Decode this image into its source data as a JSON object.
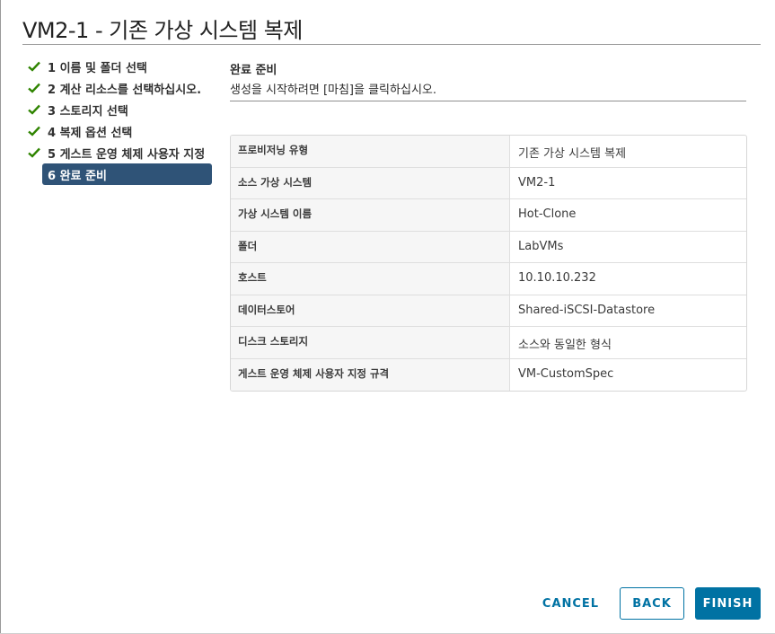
{
  "window": {
    "title": "VM2-1 - 기존 가상 시스템 복제"
  },
  "steps": [
    {
      "label": "1 이름 및 폴더 선택",
      "completed": true
    },
    {
      "label": "2 계산 리소스를 선택하십시오.",
      "completed": true
    },
    {
      "label": "3 스토리지 선택",
      "completed": true
    },
    {
      "label": "4 복제 옵션 선택",
      "completed": true
    },
    {
      "label": "5 게스트 운영 체제 사용자 지정",
      "completed": true
    },
    {
      "label": "6 완료 준비",
      "completed": false,
      "active": true
    }
  ],
  "content": {
    "title": "완료 준비",
    "description": "생성을 시작하려면 [마침]을 클릭하십시오."
  },
  "summary": [
    {
      "label": "프로비저닝 유형",
      "value": "기존 가상 시스템 복제"
    },
    {
      "label": "소스 가상 시스템",
      "value": "VM2-1"
    },
    {
      "label": "가상 시스템 이름",
      "value": "Hot-Clone"
    },
    {
      "label": "폴더",
      "value": "LabVMs"
    },
    {
      "label": "호스트",
      "value": "10.10.10.232"
    },
    {
      "label": "데이터스토어",
      "value": "Shared-iSCSI-Datastore"
    },
    {
      "label": "디스크 스토리지",
      "value": "소스와 동일한 형식"
    },
    {
      "label": "게스트 운영 체제 사용자 지정 규격",
      "value": "VM-CustomSpec"
    }
  ],
  "buttons": {
    "cancel": "CANCEL",
    "back": "BACK",
    "finish": "FINISH"
  },
  "colors": {
    "accent": "#0072a3",
    "active_step": "#2f5377",
    "check": "#2f8400"
  },
  "icons": {
    "step_completed": "check-icon"
  }
}
